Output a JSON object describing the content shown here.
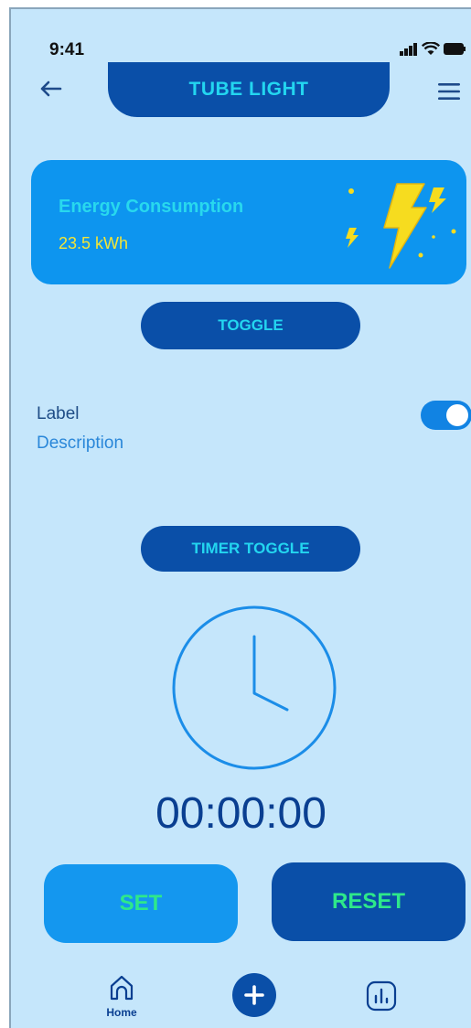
{
  "status_bar": {
    "time": "9:41"
  },
  "header": {
    "title": "TUBE LIGHT",
    "back_icon": "arrow-left-icon",
    "menu_icon": "hamburger-menu-icon"
  },
  "energy_card": {
    "label": "Energy Consumption",
    "value": "23.5 kWh",
    "icon": "lightning-bolt-icon"
  },
  "toggle_button": {
    "label": "TOGGLE"
  },
  "setting_row": {
    "label": "Label",
    "description": "Description",
    "switch_on": true
  },
  "timer": {
    "toggle_label": "TIMER TOGGLE",
    "clock_icon": "clock-icon",
    "readout": "00:00:00",
    "set_label": "SET",
    "reset_label": "RESET"
  },
  "bottom_nav": {
    "home_label": "Home",
    "home_icon": "home-icon",
    "add_icon": "plus-icon",
    "stats_icon": "bar-chart-icon"
  },
  "colors": {
    "background": "#c5e6fb",
    "primary_dark": "#0a4fa8",
    "primary": "#0d95ef",
    "accent_cyan": "#23d6f0",
    "accent_green": "#2ee88a",
    "accent_yellow": "#f4e536"
  }
}
